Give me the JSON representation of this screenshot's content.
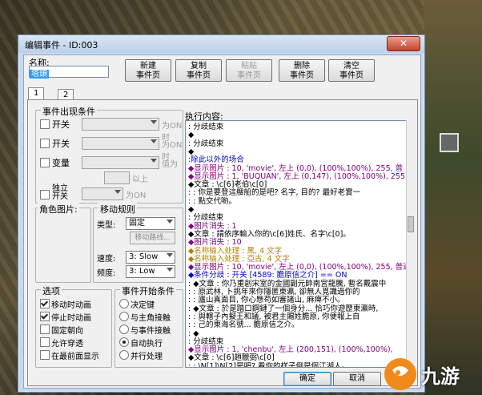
{
  "window": {
    "title": "编辑事件 - ID:003",
    "close": "✕"
  },
  "name": {
    "label": "名称:",
    "value": "塔頭"
  },
  "toolbar": [
    {
      "label": "新建\n事件页"
    },
    {
      "label": "复制\n事件页"
    },
    {
      "label": "粘贴\n事件页"
    },
    {
      "label": "删除\n事件页"
    },
    {
      "label": "清空\n事件页"
    }
  ],
  "tabs": [
    "1",
    "2"
  ],
  "conditions": {
    "title": "事件出现条件",
    "switch1": "开关",
    "switch1_suffix": "为ON时",
    "switch2": "开关",
    "switch2_suffix": "为ON时",
    "variable": "变量",
    "variable_suffix": "值为",
    "above": "以上",
    "self_switch": "独立\n开关",
    "self_switch_suffix": "为ON"
  },
  "image": {
    "title": "角色图片:"
  },
  "movement": {
    "title": "移动规则",
    "type_label": "类型:",
    "type_value": "固定",
    "route": "移动路线...",
    "speed_label": "速度:",
    "speed_value": "3: Slow",
    "freq_label": "频度:",
    "freq_value": "3: Low"
  },
  "options": {
    "title": "选项",
    "items": [
      {
        "label": "移动时动画",
        "checked": true
      },
      {
        "label": "停止时动画",
        "checked": true
      },
      {
        "label": "固定朝向",
        "checked": false
      },
      {
        "label": "允许穿透",
        "checked": false
      },
      {
        "label": "在最前面显示",
        "checked": false
      }
    ]
  },
  "trigger": {
    "title": "事件开始条件",
    "items": [
      {
        "label": "决定键",
        "on": false
      },
      {
        "label": "与主角接触",
        "on": false
      },
      {
        "label": "与事件接触",
        "on": false
      },
      {
        "label": "自动执行",
        "on": true
      },
      {
        "label": "并行处理",
        "on": false
      }
    ]
  },
  "exec": {
    "title": "执行内容:",
    "lines": [
      {
        "t": " :  分歧结束",
        "c": "c-k"
      },
      {
        "t": "  ◆",
        "c": "c-k"
      },
      {
        "t": " : 分歧结束",
        "c": "c-k"
      },
      {
        "t": "◆",
        "c": "c-k"
      },
      {
        "t": " :除此以外的场合",
        "c": "c-b"
      },
      {
        "t": " ◆显示图片 : 10, 'movie', 左上 (0,0), (100%,100%), 255, 普",
        "c": "c-p"
      },
      {
        "t": " ◆显示图片 : 1, 'BUQUAN', 左上 (0,147), (100%,100%), 255,",
        "c": "c-p"
      },
      {
        "t": " ◆文章 : \\c[6]老伯\\c[0]",
        "c": "c-k"
      },
      {
        "t": " :      : 你是要登這艘船的是吧? 名字, 目的? 最好老實一",
        "c": "c-k"
      },
      {
        "t": " :      : 點交代喲。",
        "c": "c-k"
      },
      {
        "t": " ◆",
        "c": "c-k"
      },
      {
        "t": " :  分歧结束",
        "c": "c-k"
      },
      {
        "t": " ◆图片消失 : 1",
        "c": "c-p"
      },
      {
        "t": " ◆文章 : 請依序輸入你的\\c[6]姓氏、名字\\c[0]。",
        "c": "c-k"
      },
      {
        "t": " ◆图片消失 : 10",
        "c": "c-p"
      },
      {
        "t": " ◆名称输入处理 : 黑, 4 文字",
        "c": "c-o"
      },
      {
        "t": " ◆名称输入处理 : 亞古, 4 文字",
        "c": "c-o"
      },
      {
        "t": " ◆显示图片 : 10, 'movie', 左上 (0,0), (100%,100%), 255, 普通",
        "c": "c-p"
      },
      {
        "t": " ◆条件分歧 : 开关 [4589: 膽原信之介] == ON",
        "c": "c-b"
      },
      {
        "t": " :  ◆文章 : 你乃重創宋室的金國副元帥南宮龍騰, 暫名戴震中",
        "c": "c-k"
      },
      {
        "t": " :      : 原武林, 卜挑年來你隱匿東瀛, 卻無人覓識過你的",
        "c": "c-k"
      },
      {
        "t": " :      : 廬山真面目, 你心懸苟如審諸山, 麻痺不小。",
        "c": "c-k"
      },
      {
        "t": " :  ◆文章 : 於是踏口鋼鏈了一個身分... 恰巧你遊歷東瀛時,",
        "c": "c-k"
      },
      {
        "t": " :      : 與轄子內擬王和議, 被君主賜姓膽原, 你便報上自",
        "c": "c-k"
      },
      {
        "t": " :      : 己的東海名號... 膽原信之介。",
        "c": "c-k"
      },
      {
        "t": " :  ◆",
        "c": "c-k"
      },
      {
        "t": " :  分歧结束",
        "c": "c-k"
      },
      {
        "t": " ◆显示图片 : 1, 'chenbu', 左上 (200,151), (100%,100%),",
        "c": "c-p"
      },
      {
        "t": " ◆文章 : \\c[6]趙臘弼\\c[0]",
        "c": "c-k"
      },
      {
        "t": " :      : \\N[1]\\N[2]是吧? 看你的样子倒是個江湖人。",
        "c": "c-k"
      }
    ]
  },
  "buttons": {
    "ok": "确定",
    "cancel": "取消"
  },
  "watermark": {
    "text": "九游"
  }
}
